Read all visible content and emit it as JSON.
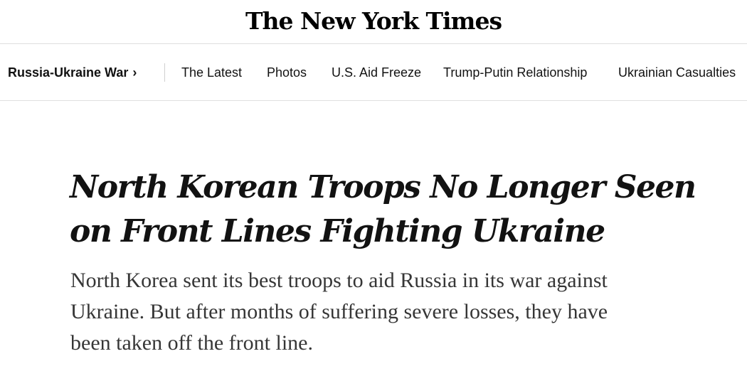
{
  "masthead": {
    "logo_text": "The New York Times"
  },
  "subnav": {
    "section_label": "Russia-Ukraine War",
    "section_chevron": "›",
    "items": [
      {
        "label": "The Latest"
      },
      {
        "label": "Photos"
      },
      {
        "label": "U.S. Aid Freeze"
      },
      {
        "label": "Trump-Putin Relationship"
      },
      {
        "label": "Ukrainian Casualties"
      }
    ]
  },
  "article": {
    "headline_line1": "North Korean Troops No Longer Seen",
    "headline_line2": "on Front Lines Fighting Ukraine",
    "dek_line1": "North Korea sent its best troops to aid Russia in its war against",
    "dek_line2": "Ukraine. But after months of suffering severe losses, they have",
    "dek_line3": "been taken off the front line."
  },
  "colors": {
    "text": "#121212",
    "dek_text": "#363636",
    "divider": "#dfdfdf"
  }
}
